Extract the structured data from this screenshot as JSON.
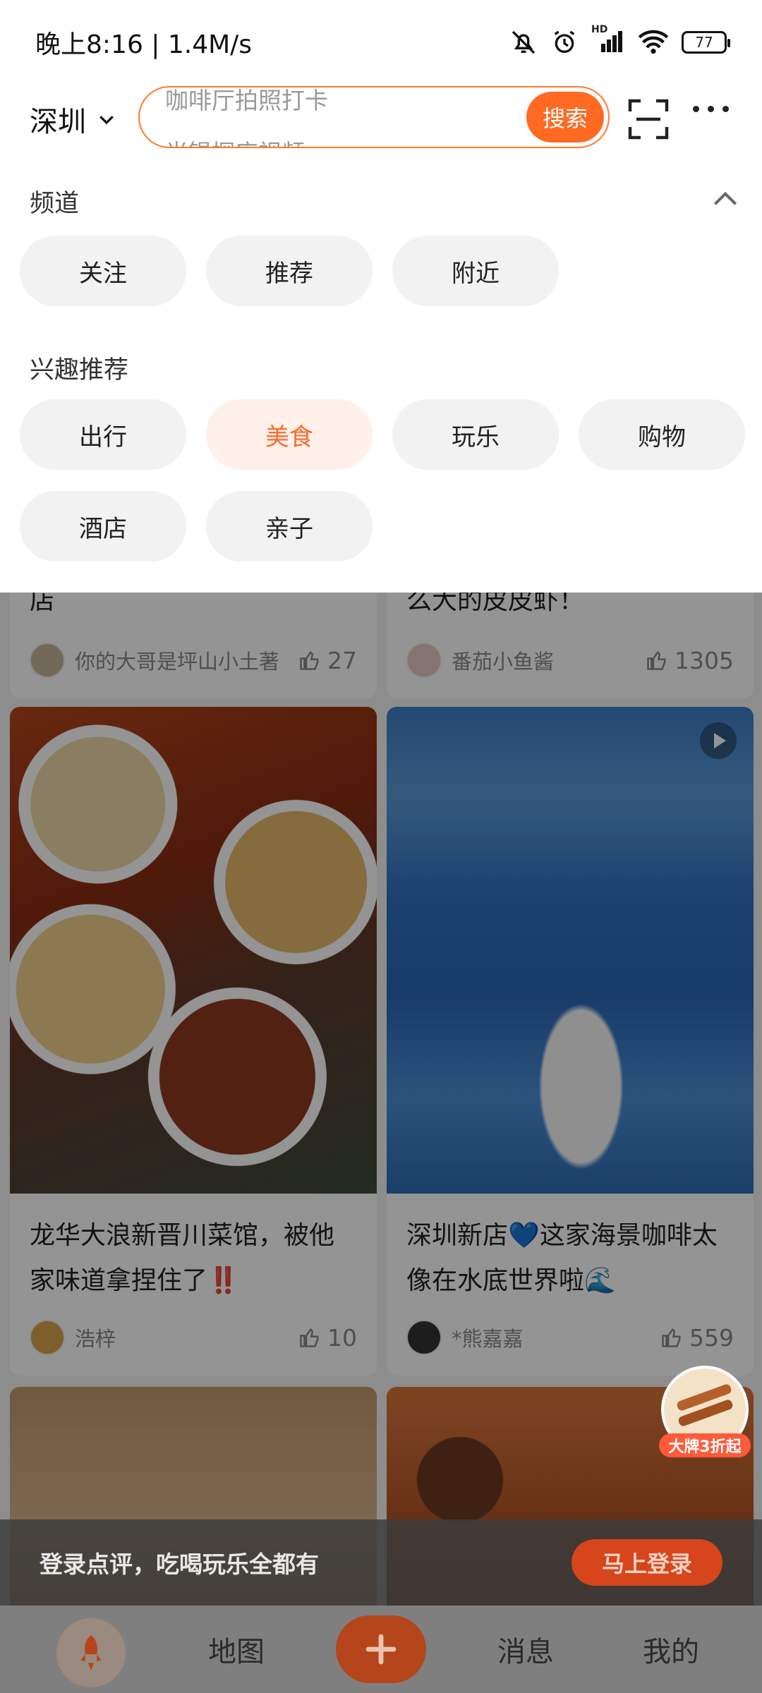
{
  "status_bar": {
    "time": "晚上8:16 | 1.4M/s",
    "battery": "77",
    "hd_label": "HD"
  },
  "search": {
    "city": "深圳",
    "hint_top": "咖啡厅拍照打卡",
    "hint_bottom": "光锟探店视频",
    "button": "搜索"
  },
  "channels": {
    "label": "频道",
    "items": [
      "关注",
      "推荐",
      "附近"
    ]
  },
  "interests": {
    "label": "兴趣推荐",
    "items": [
      "出行",
      "美食",
      "玩乐",
      "购物",
      "酒店",
      "亲子"
    ],
    "active": "美食"
  },
  "feed": {
    "partial_left": {
      "title_tail": "店",
      "author": "你的大哥是坪山小土著",
      "likes": "27"
    },
    "partial_right": {
      "title_tail": "么大的皮皮虾！",
      "author": "番茄小鱼酱",
      "likes": "1305"
    },
    "card_left": {
      "title": "龙华大浪新晋川菜馆，被他家味道拿捏住了‼️",
      "author": "浩梓",
      "likes": "10"
    },
    "card_right": {
      "title": "深圳新店💙这家海景咖啡太像在水底世界啦🌊",
      "author": "*熊嘉嘉",
      "likes": "559"
    },
    "promo_badge": "大牌3折起"
  },
  "login_bar": {
    "text": "登录点评，吃喝玩乐全都有",
    "button": "马上登录"
  },
  "bottom_nav": {
    "items": [
      "地图",
      "消息",
      "我的"
    ]
  },
  "colors": {
    "accent": "#ff6a22",
    "active_chip_bg": "#fff0ea",
    "active_chip_text": "#ff6a2a"
  }
}
